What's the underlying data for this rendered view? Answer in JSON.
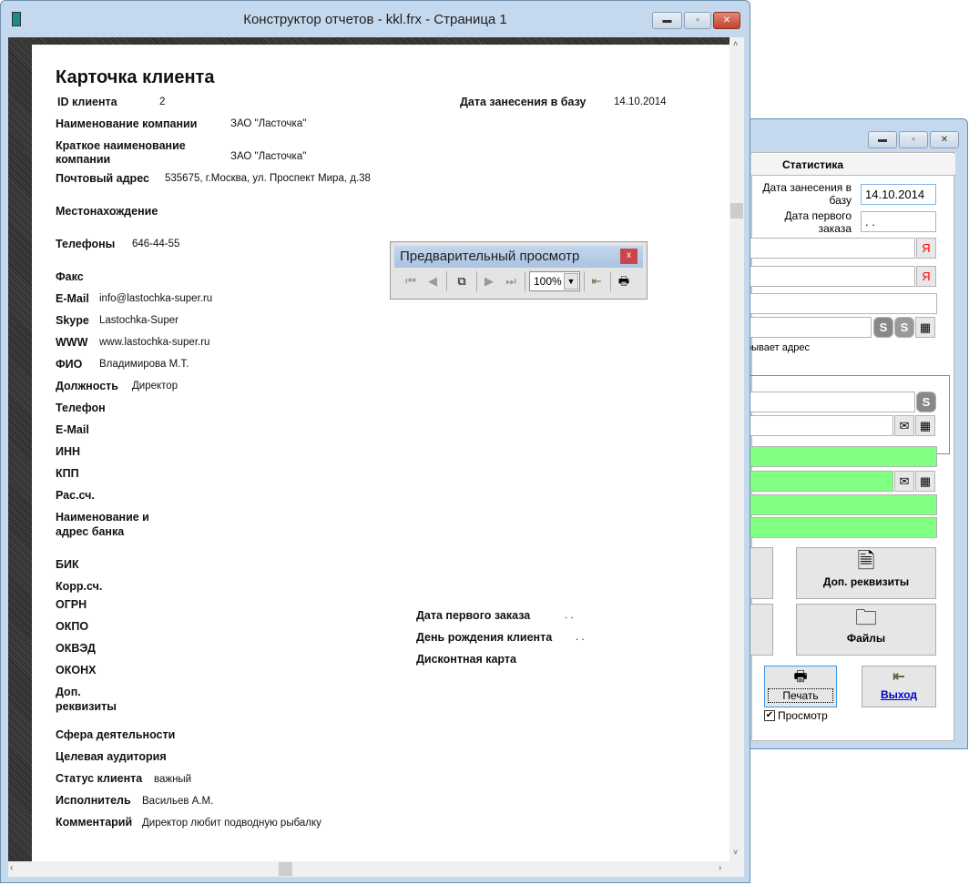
{
  "back_window": {
    "tab_label": "Статистика",
    "date_added_label": "Дата занесения в базу",
    "date_added_value": "14.10.2014",
    "first_order_label": "Дата первого заказа",
    "first_order_value": " . .",
    "yandex_btn": "Я",
    "address_hint": "рывает адрес",
    "extra_details_btn": "Доп. реквизиты",
    "files_btn": "Файлы",
    "print_btn": "Печать",
    "exit_btn": "Выход",
    "preview_checkbox": "Просмотр",
    "preview_checked": true,
    "green_color": "#80ff80"
  },
  "main_window": {
    "title": "Конструктор отчетов - kkl.frx - Страница 1"
  },
  "preview_toolbar": {
    "title": "Предварительный просмотр",
    "zoom": "100%",
    "close": "x"
  },
  "report": {
    "heading": "Карточка клиента",
    "id_label": "ID клиента",
    "id_value": "2",
    "date_label": "Дата занесения в базу",
    "date_value": "14.10.2014",
    "company_label": "Наименование компании",
    "company_value": "ЗАО \"Ласточка\"",
    "short_label_1": "Краткое наименование",
    "short_label_2": "компании",
    "short_value": "ЗАО \"Ласточка\"",
    "postal_label": "Почтовый адрес",
    "postal_value": "535675, г.Москва, ул. Проспект Мира, д.38",
    "location_label": "Местонахождение",
    "phones_label": "Телефоны",
    "phones_value": "646-44-55",
    "fax_label": "Факс",
    "email_label": "E-Mail",
    "email_value": "info@lastochka-super.ru",
    "skype_label": "Skype",
    "skype_value": "Lastochka-Super",
    "www_label": "WWW",
    "www_value": "www.lastochka-super.ru",
    "fio_label": "ФИО",
    "fio_value": "Владимирова М.Т.",
    "position_label": "Должность",
    "position_value": "Директор",
    "phone_label": "Телефон",
    "email2_label": "E-Mail",
    "inn_label": "ИНН",
    "kpp_label": "КПП",
    "account_label": "Рас.сч.",
    "bank_label_1": "Наименование и",
    "bank_label_2": "адрес банка",
    "bik_label": "БИК",
    "corr_label": "Корр.сч.",
    "ogrn_label": "ОГРН",
    "okpo_label": "ОКПО",
    "okved_label": "ОКВЭД",
    "okonh_label": "ОКОНХ",
    "extra_label_1": "Доп.",
    "extra_label_2": "реквизиты",
    "sphere_label": "Сфера деятельности",
    "audience_label": "Целевая аудитория",
    "status_label": "Статус клиента",
    "status_value": "важный",
    "executor_label": "Исполнитель",
    "executor_value": "Васильев А.М.",
    "comment_label": "Комментарий",
    "comment_value": "Директор любит подводную рыбалку",
    "first_order_label": "Дата первого заказа",
    "first_order_value": ". .",
    "birthday_label": "День рождения клиента",
    "birthday_value": ". .",
    "discount_label": "Дисконтная карта"
  }
}
